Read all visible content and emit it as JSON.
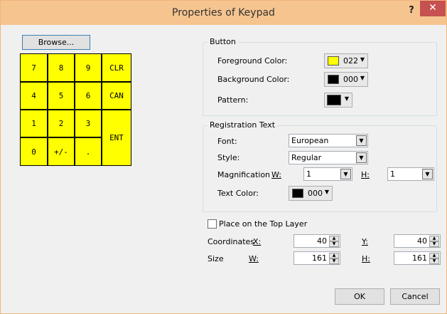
{
  "window": {
    "title": "Properties of Keypad",
    "help": "?",
    "close": "✕"
  },
  "browse_label": "Browse...",
  "keypad": {
    "keys": [
      "7",
      "8",
      "9",
      "CLR",
      "4",
      "5",
      "6",
      "CAN",
      "1",
      "2",
      "3",
      "ENT",
      "0",
      "+/-",
      "."
    ],
    "key_color": "#ffff00"
  },
  "button_group": {
    "title": "Button",
    "fg_label": "Foreground Color:",
    "fg_value": "022",
    "fg_color": "#ffff00",
    "bg_label": "Background Color:",
    "bg_value": "000",
    "bg_color": "#000000",
    "pattern_label": "Pattern:",
    "pattern_color": "#000000"
  },
  "registration_group": {
    "title": "Registration Text",
    "font_label": "Font:",
    "font_value": "European",
    "style_label": "Style:",
    "style_value": "Regular",
    "magnification_label": "Magnification",
    "w_label": "W:",
    "w_value": "1",
    "h_label": "H:",
    "h_value": "1",
    "text_color_label": "Text Color:",
    "text_color_value": "000",
    "text_color": "#000000"
  },
  "top_layer_label": "Place on the Top Layer",
  "coordinates": {
    "label": "Coordinates",
    "x_label": "X:",
    "x_value": "40",
    "y_label": "Y:",
    "y_value": "40"
  },
  "size": {
    "label": "Size",
    "w_label": "W:",
    "w_value": "161",
    "h_label": "H:",
    "h_value": "161"
  },
  "ok_label": "OK",
  "cancel_label": "Cancel"
}
